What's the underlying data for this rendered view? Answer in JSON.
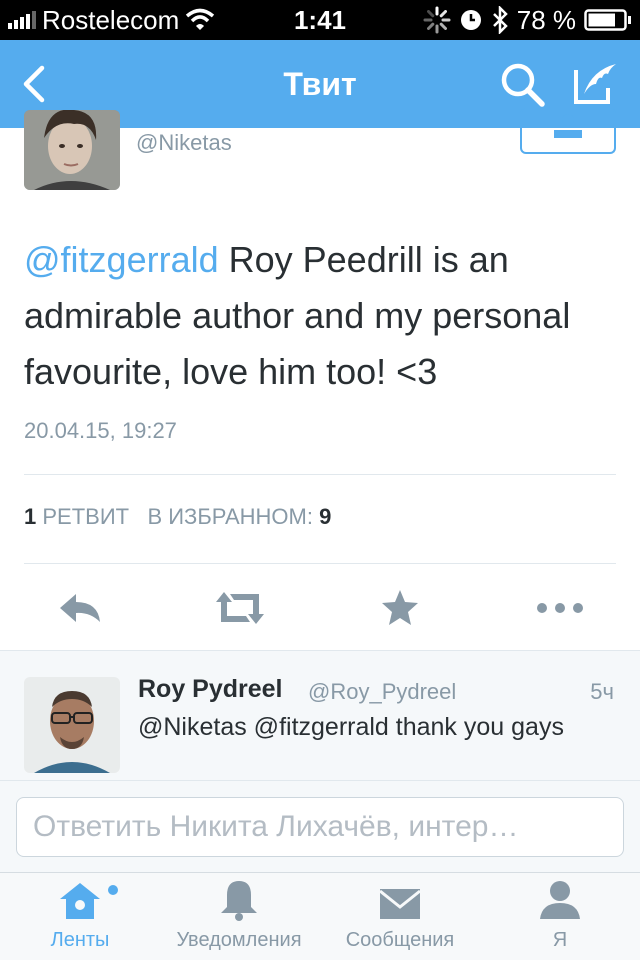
{
  "status_bar": {
    "carrier": "Rostelecom",
    "time": "1:41",
    "battery": "78 %",
    "battery_level": 0.78
  },
  "nav": {
    "title": "Твит"
  },
  "tweet": {
    "handle": "@Niketas",
    "mention": "@fitzgerrald",
    "text": " Roy Peedrill is an admirable author and my personal favourite, love him too! <3",
    "timestamp": "20.04.15, 19:27",
    "retweet_count": "1",
    "retweet_label": "РЕТВИТ",
    "favorites_label": "В ИЗБРАННОМ:",
    "favorites_count": "9"
  },
  "reply": {
    "name": "Roy Pydreel",
    "handle": "@Roy_Pydreel",
    "age": "5ч",
    "text": "@Niketas @fitzgerrald thank you gays"
  },
  "compose": {
    "placeholder": "Ответить Никита Лихачёв, интер…"
  },
  "tabs": [
    {
      "label": "Ленты",
      "icon": "home-icon",
      "active": true
    },
    {
      "label": "Уведомления",
      "icon": "bell-icon",
      "active": false
    },
    {
      "label": "Сообщения",
      "icon": "envelope-icon",
      "active": false
    },
    {
      "label": "Я",
      "icon": "person-icon",
      "active": false
    }
  ],
  "colors": {
    "accent": "#55acee",
    "muted": "#8899a6",
    "text": "#292f33"
  }
}
